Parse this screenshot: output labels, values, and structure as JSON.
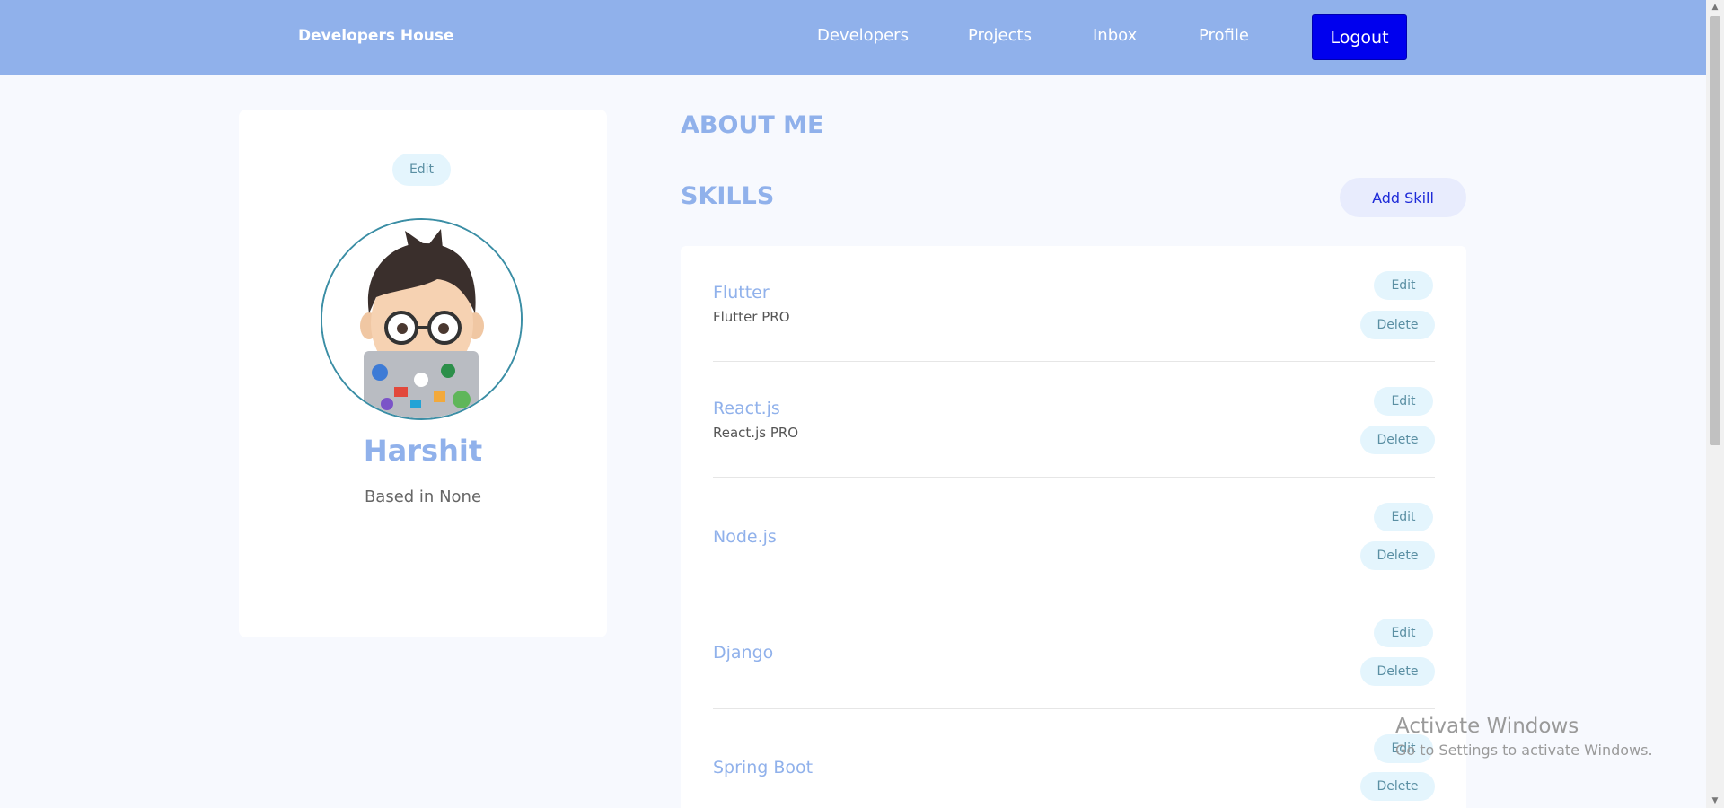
{
  "navbar": {
    "brand": "Developers House",
    "links": [
      "Developers",
      "Projects",
      "Inbox",
      "Profile"
    ],
    "logout_label": "Logout"
  },
  "profile": {
    "edit_label": "Edit",
    "name": "Harshit",
    "location": "Based in None"
  },
  "about": {
    "heading": "ABOUT ME"
  },
  "skills": {
    "heading": "SKILLS",
    "add_label": "Add Skill",
    "edit_label": "Edit",
    "delete_label": "Delete",
    "items": [
      {
        "name": "Flutter",
        "description": "Flutter PRO"
      },
      {
        "name": "React.js",
        "description": "React.js PRO"
      },
      {
        "name": "Node.js",
        "description": ""
      },
      {
        "name": "Django",
        "description": ""
      },
      {
        "name": "Spring Boot",
        "description": ""
      }
    ]
  },
  "watermark": {
    "title": "Activate Windows",
    "subtitle": "Go to Settings to activate Windows."
  },
  "colors": {
    "navbar": "#90b1eb",
    "accent": "#90b1eb",
    "logout": "#0000ee",
    "pill": "#e4f5fd",
    "page_bg": "#f7f9fe"
  }
}
